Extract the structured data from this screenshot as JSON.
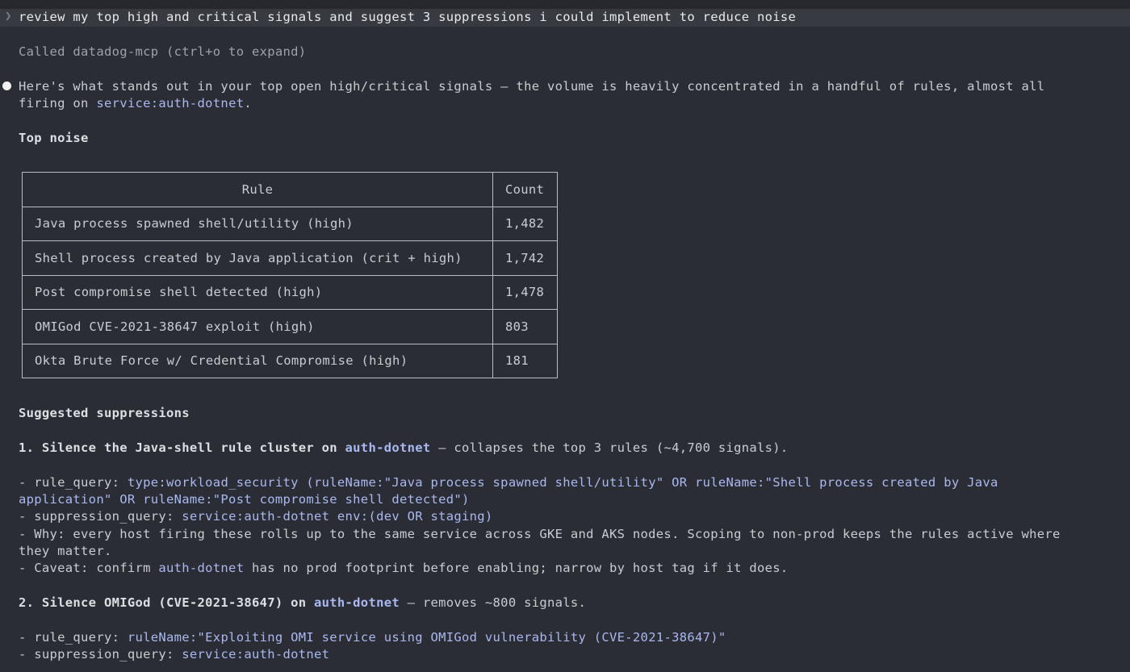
{
  "prompt": {
    "caret": "❯",
    "text": "review my top high and critical signals and suggest 3 suppressions i could implement to reduce noise"
  },
  "tool_call": "Called datadog-mcp (ctrl+o to expand)",
  "intro": {
    "line1": "Here's what stands out in your top open high/critical signals — the volume is heavily concentrated in a handful of rules, almost all",
    "line2_prefix": "firing on ",
    "line2_code": "service:auth-dotnet",
    "line2_suffix": "."
  },
  "top_noise_heading": "Top noise",
  "table": {
    "headers": [
      "Rule",
      "Count"
    ],
    "rows": [
      {
        "rule": "Java process spawned shell/utility (high)",
        "count": "1,482"
      },
      {
        "rule": "Shell process created by Java application (crit + high)",
        "count": "1,742"
      },
      {
        "rule": "Post compromise shell detected (high)",
        "count": "1,478"
      },
      {
        "rule": "OMIGod CVE-2021-38647 exploit (high)",
        "count": "803"
      },
      {
        "rule": "Okta Brute Force w/ Credential Compromise (high)",
        "count": "181"
      }
    ]
  },
  "suggested_heading": "Suggested suppressions",
  "s1": {
    "title_prefix": "1. Silence the Java-shell rule cluster on ",
    "title_code": "auth-dotnet",
    "title_suffix": " — collapses the top 3 rules (~4,700 signals).",
    "rq_label": "- rule_query: ",
    "rq_line1": "type:workload_security (ruleName:\"Java process spawned shell/utility\" OR ruleName:\"Shell process created by Java",
    "rq_line2": "application\" OR ruleName:\"Post compromise shell detected\")",
    "sq_label": "- suppression_query: ",
    "sq_value": "service:auth-dotnet env:(dev OR staging)",
    "why_line1": "- Why: every host firing these rolls up to the same service across GKE and AKS nodes. Scoping to non-prod keeps the rules active where",
    "why_line2": "they matter.",
    "caveat_prefix": "- Caveat: confirm ",
    "caveat_code": "auth-dotnet",
    "caveat_suffix": " has no prod footprint before enabling; narrow by host tag if it does."
  },
  "s2": {
    "title_prefix": "2. Silence OMIGod (CVE-2021-38647) on ",
    "title_code": "auth-dotnet",
    "title_suffix": " — removes ~800 signals.",
    "rq_label": "- rule_query: ",
    "rq_value": "ruleName:\"Exploiting OMI service using OMIGod vulnerability (CVE-2021-38647)\"",
    "sq_label": "- suppression_query: ",
    "sq_value": "service:auth-dotnet"
  }
}
